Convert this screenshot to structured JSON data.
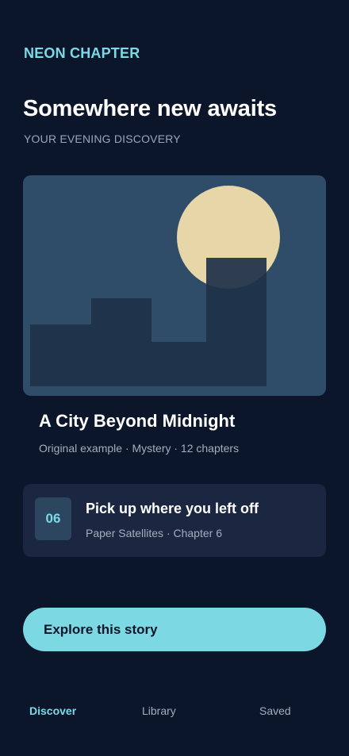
{
  "brand": "NEON CHAPTER",
  "header": {
    "title": "Somewhere new awaits",
    "subtitle": "YOUR EVENING DISCOVERY"
  },
  "featured": {
    "illustration": "night-city-moon",
    "title": "A City Beyond Midnight",
    "meta": "Original example · Mystery · 12 chapters"
  },
  "continue_reading": {
    "chapter_number": "06",
    "title": "Pick up where you left off",
    "meta": "Paper Satellites · Chapter 6"
  },
  "cta": {
    "label": "Explore this story"
  },
  "bottom_nav": {
    "items": [
      {
        "label": "Discover",
        "active": true
      },
      {
        "label": "Library",
        "active": false
      },
      {
        "label": "Saved",
        "active": false
      }
    ]
  },
  "colors": {
    "background": "#0c162a",
    "accent": "#7dd9e6",
    "card": "#1b2740",
    "hero": "#2f4d69",
    "moon": "#e6d6a8",
    "buildings": "#1e3149"
  }
}
